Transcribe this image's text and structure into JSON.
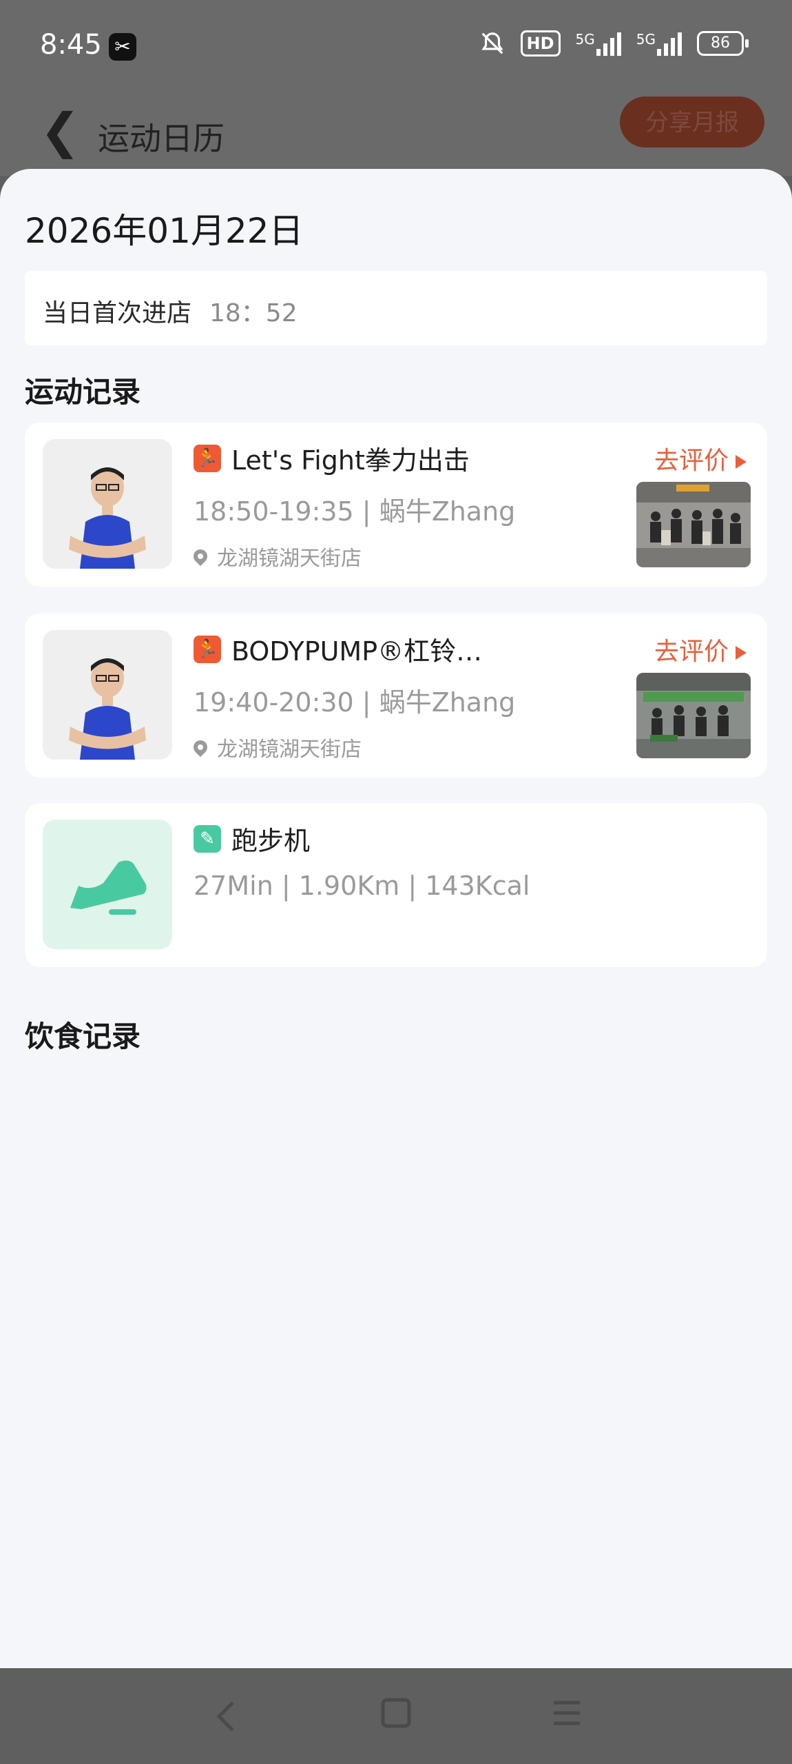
{
  "status": {
    "time": "8:45",
    "net1": "5G",
    "net2": "5G",
    "hd": "HD",
    "battery": "86"
  },
  "nav": {
    "back_symbol": "❮",
    "title": "运动日历",
    "share_label": "分享月报"
  },
  "date": "2026年01月22日",
  "first_entry": {
    "label": "当日首次进店",
    "time": "18：52"
  },
  "sections": {
    "exercise": "运动记录",
    "diet": "饮食记录"
  },
  "records": [
    {
      "title": "Let's Fight拳力出击",
      "subtitle": "18:50-19:35 | 蜗牛Zhang",
      "location": "龙湖镜湖天街店",
      "action": "去评价"
    },
    {
      "title": "BODYPUMP®杠铃…",
      "subtitle": "19:40-20:30 | 蜗牛Zhang",
      "location": "龙湖镜湖天街店",
      "action": "去评价"
    },
    {
      "title": "跑步机",
      "subtitle": "27Min | 1.90Km | 143Kcal"
    }
  ],
  "colors": {
    "accent": "#e8603b",
    "badge_orange": "#ef5a33",
    "badge_green": "#49c9a0",
    "tread_bg": "#dff5ec"
  }
}
